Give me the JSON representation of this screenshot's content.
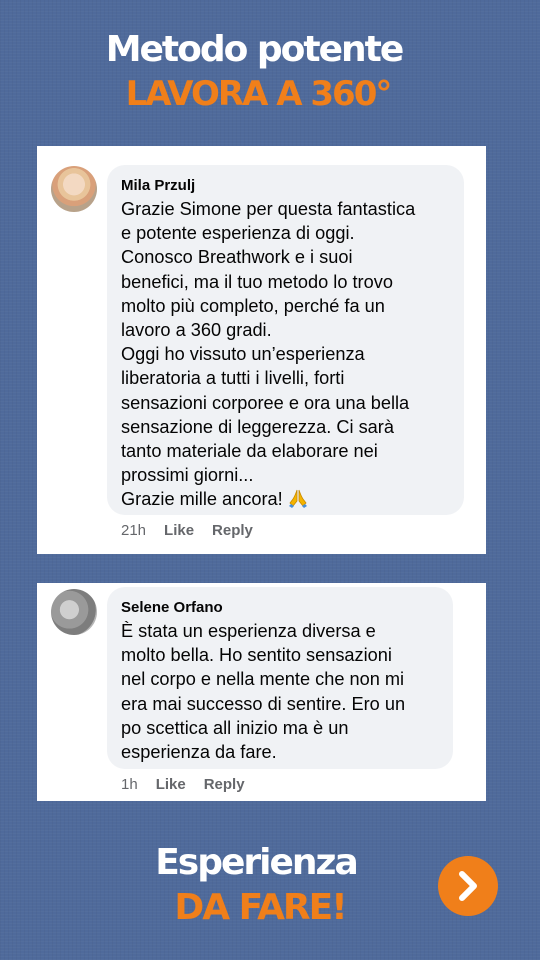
{
  "header": {
    "line1": "Metodo potente",
    "line2": "LAVORA A 360°"
  },
  "comments": [
    {
      "author": "Mila Przulj",
      "lines": [
        "Grazie Simone per questa fantastica",
        "e potente esperienza di oggi.",
        "Conosco Breathwork e i suoi",
        "benefici, ma il tuo metodo lo trovo",
        "molto più completo, perché fa un",
        "lavoro a 360 gradi.",
        "Oggi ho vissuto un’esperienza",
        "liberatoria a tutti i livelli, forti",
        "sensazioni corporee e ora una bella",
        "sensazione di leggerezza. Ci sarà",
        "tanto materiale da elaborare nei",
        "prossimi giorni...",
        "Grazie mille ancora!"
      ],
      "emoji": "folded-hands-icon",
      "time": "21h",
      "like_label": "Like",
      "reply_label": "Reply"
    },
    {
      "author": "Selene Orfano",
      "lines": [
        "È stata un esperienza diversa e",
        "molto bella. Ho sentito sensazioni",
        "nel corpo e nella mente che non mi",
        "era mai successo di sentire. Ero un",
        "po scettica all inizio ma è un",
        "esperienza da fare."
      ],
      "time": "1h",
      "like_label": "Like",
      "reply_label": "Reply"
    }
  ],
  "footer": {
    "line1": "Esperienza",
    "line2": "DA FARE!"
  },
  "next_button_icon": "chevron-right-icon",
  "colors": {
    "background": "#4f6a9b",
    "accent": "#f07f1a",
    "bubble": "#f0f2f5"
  }
}
